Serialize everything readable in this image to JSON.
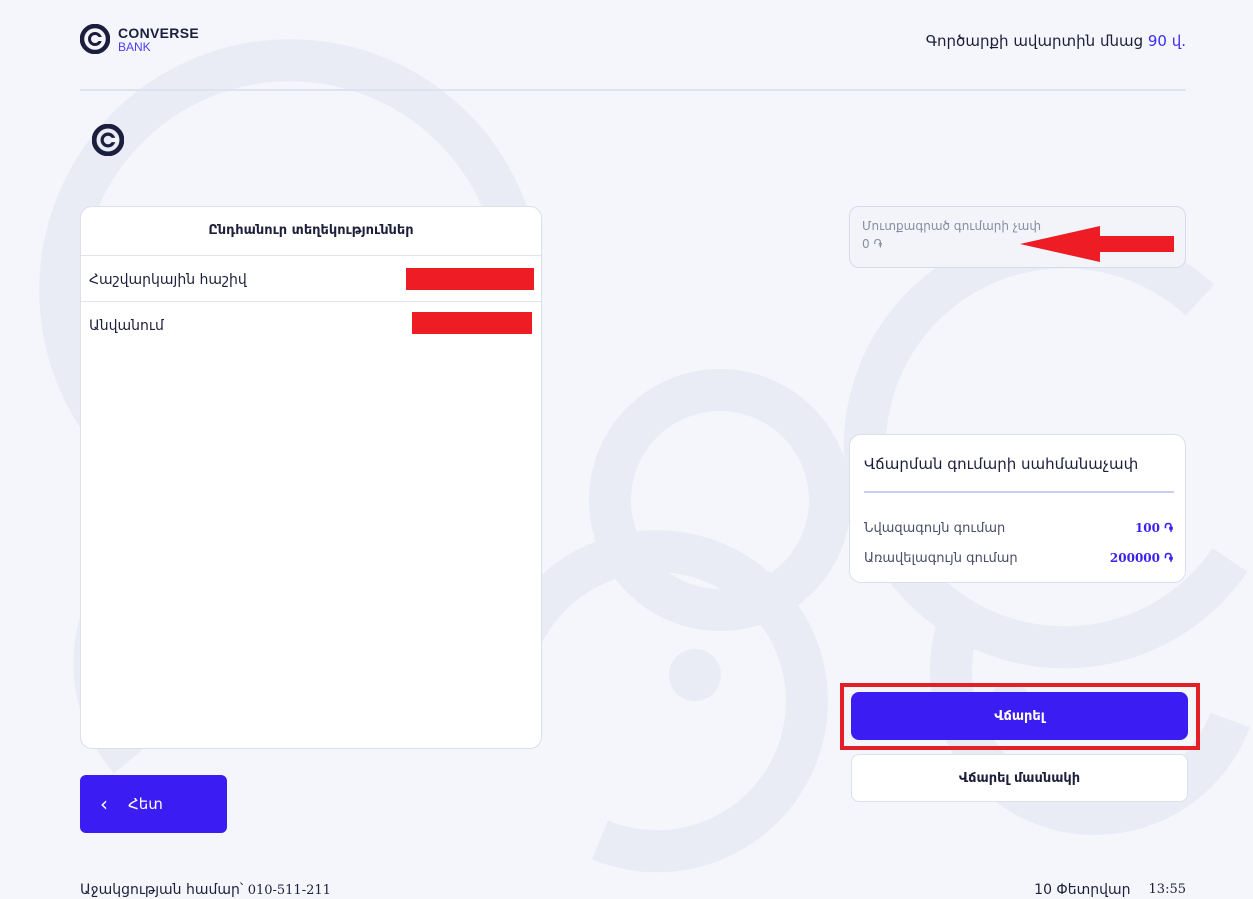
{
  "brand": {
    "name": "CONVERSE",
    "sub": "BANK"
  },
  "header": {
    "timer_prefix": "Գործարքի ավարտին մնաց",
    "timer_value": "90 վ."
  },
  "info": {
    "title": "Ընդհանուր տեղեկություններ",
    "rows": [
      {
        "label": "Հաշվարկային հաշիվ"
      },
      {
        "label": "Անվանում"
      }
    ]
  },
  "back_button": {
    "label": "Հետ"
  },
  "amount": {
    "label": "Մուտքագրած գումարի չափ",
    "value": "0 ֏"
  },
  "limits": {
    "title": "Վճարման գումարի սահմանաչափ",
    "min_label": "Նվազագույն գումար",
    "min_value": "100 ֏",
    "max_label": "Առավելագույն գումար",
    "max_value": "200000 ֏"
  },
  "actions": {
    "pay": "Վճարել",
    "pay_partial": "Վճարել մասնակի"
  },
  "footer": {
    "support_label": "Աջակցության համար՝",
    "support_number": "010-511-211",
    "date": "10 Փետրվար",
    "time": "13:55"
  },
  "colors": {
    "accent": "#3b1cf3",
    "highlight": "#e32028",
    "redaction": "#ee1c25"
  }
}
